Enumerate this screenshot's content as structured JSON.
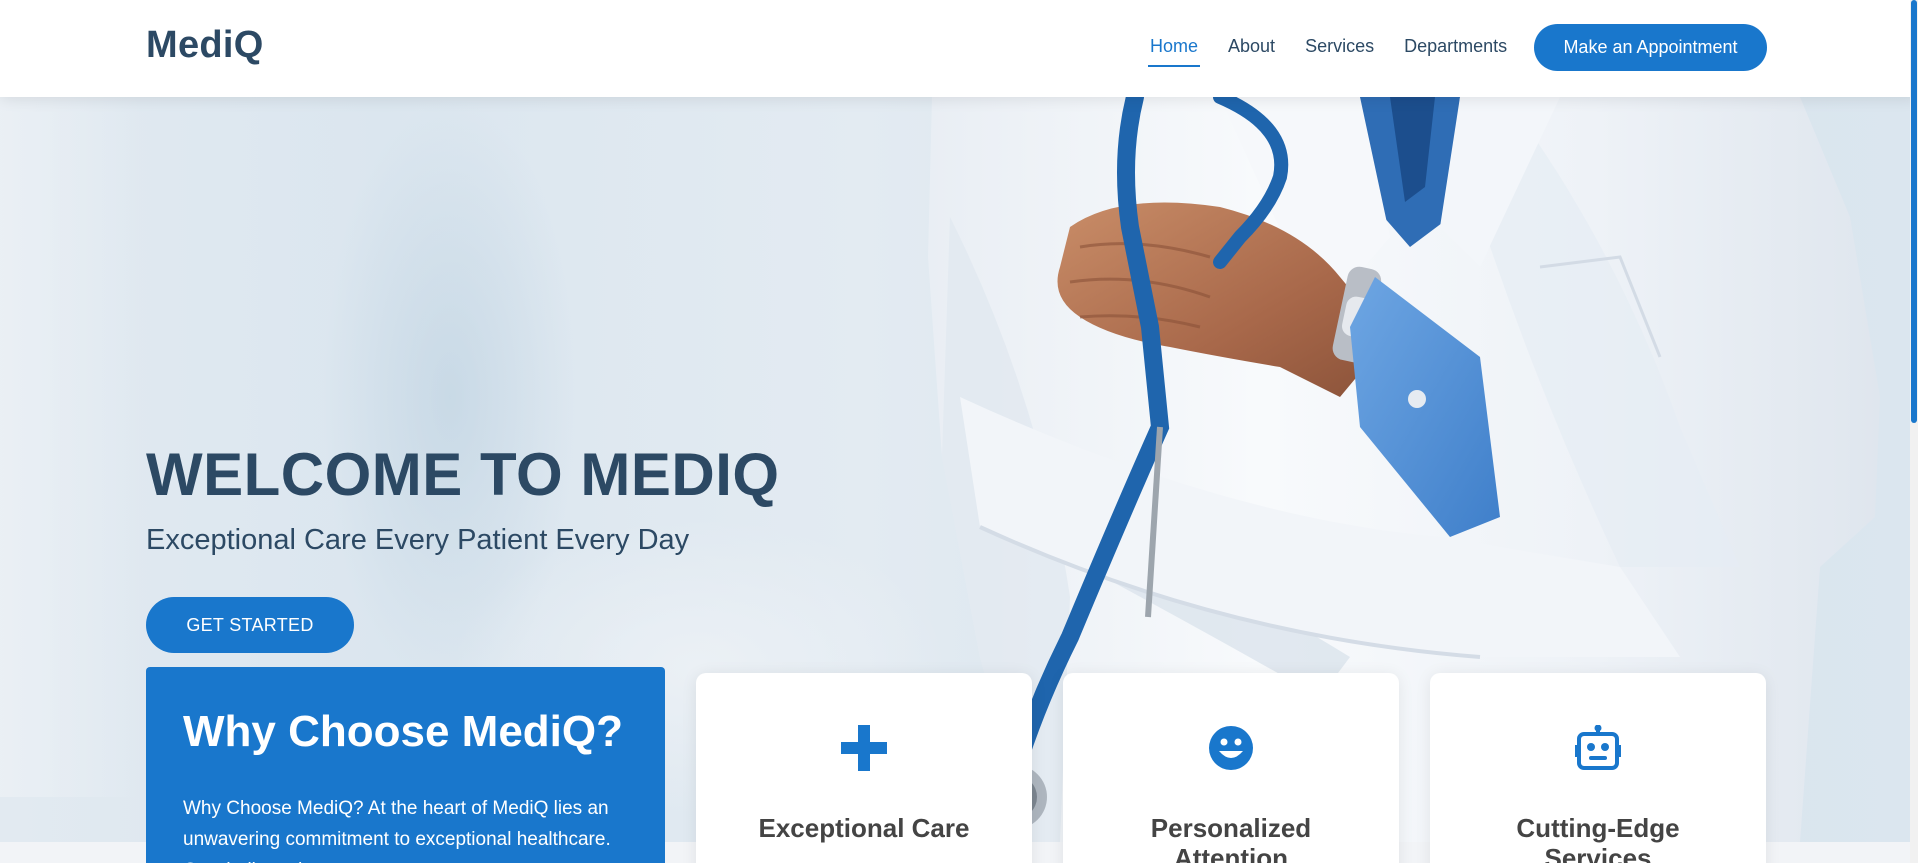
{
  "brand": {
    "logo": "MediQ"
  },
  "nav": {
    "items": [
      {
        "label": "Home",
        "active": true
      },
      {
        "label": "About"
      },
      {
        "label": "Services"
      },
      {
        "label": "Departments"
      }
    ],
    "cta_label": "Make an Appointment"
  },
  "hero": {
    "title": "WELCOME TO MEDIQ",
    "subtitle": "Exceptional Care Every Patient Every Day",
    "button_label": "GET STARTED"
  },
  "why": {
    "title": "Why Choose MediQ?",
    "text": "Why Choose MediQ? At the heart of MediQ lies an unwavering commitment to exceptional healthcare. Our dedicated team"
  },
  "features": [
    {
      "icon": "plus-icon",
      "title": "Exceptional Care"
    },
    {
      "icon": "smile-icon",
      "title": "Personalized Attention"
    },
    {
      "icon": "robot-icon",
      "title": "Cutting-Edge Services"
    }
  ],
  "colors": {
    "accent": "#1977cc",
    "heading": "#2c4964",
    "card_title": "#444444"
  }
}
